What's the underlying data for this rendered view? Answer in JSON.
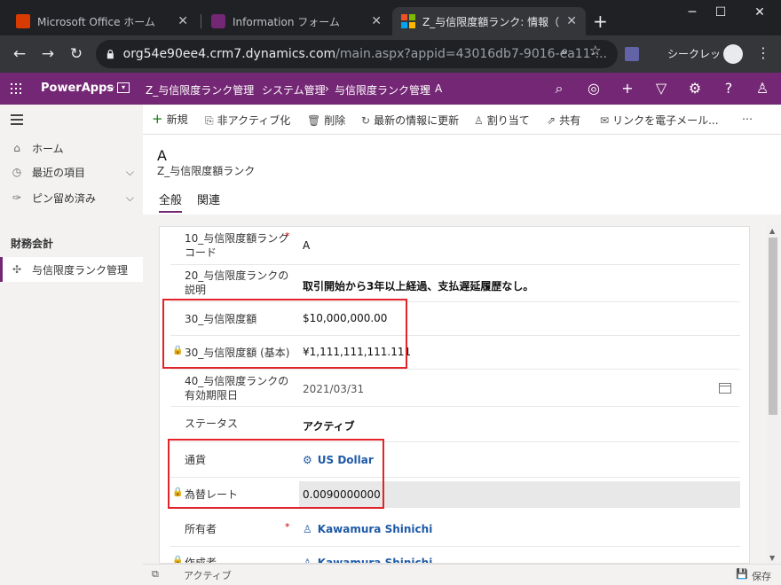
{
  "browser": {
    "tabs": [
      {
        "title": "Microsoft Office ホーム"
      },
      {
        "title": "Information フォーム"
      },
      {
        "title": "Z_与信限度額ランク: 情報（全"
      }
    ],
    "url_host": "org54e90ee4.crm7.dynamics.com",
    "url_path": "/main.aspx?appid=43016db7-9016-ea11-...",
    "incognito_label": "シークレット"
  },
  "header": {
    "brand": "PowerApps",
    "app_name": "Z_与信限度ランク管理",
    "breadcrumbs": [
      "システム管理",
      "与信限度ランク管理",
      "A"
    ],
    "brand_color": "#742774"
  },
  "nav": {
    "items": [
      {
        "label": "ホーム",
        "icon": "home-icon"
      },
      {
        "label": "最近の項目",
        "icon": "clock-icon"
      },
      {
        "label": "ピン留め済み",
        "icon": "pin-icon"
      }
    ],
    "group": "財務会計",
    "selected": {
      "label": "与信限度ランク管理",
      "icon": "puzzle-icon"
    }
  },
  "commands": [
    {
      "label": "新規",
      "icon": "plus-icon"
    },
    {
      "label": "非アクティブ化",
      "icon": "deactivate-icon"
    },
    {
      "label": "削除",
      "icon": "trash-icon"
    },
    {
      "label": "最新の情報に更新",
      "icon": "refresh-icon"
    },
    {
      "label": "割り当て",
      "icon": "person-icon"
    },
    {
      "label": "共有",
      "icon": "share-icon"
    },
    {
      "label": "リンクを電子メール...",
      "icon": "mail-icon"
    },
    {
      "label": "⋯",
      "icon": "more-icon"
    }
  ],
  "record": {
    "name": "A",
    "entity": "Z_与信限度額ランク",
    "tabs": [
      "全般",
      "関連"
    ]
  },
  "fields": [
    {
      "label": "10_与信限度額ランクコード",
      "value": "A",
      "required": true
    },
    {
      "label": "20_与信限度ランクの説明",
      "value": "取引開始から3年以上経過、支払遅延履歴なし。"
    },
    {
      "label": "30_与信限度額",
      "value": "$10,000,000.00"
    },
    {
      "label": "30_与信限度額 (基本)",
      "value": "¥1,111,111,111.111",
      "locked": true
    },
    {
      "label": "40_与信限度ランクの有効期限日",
      "value": "2021/03/31"
    },
    {
      "label": "ステータス",
      "value": "アクティブ"
    },
    {
      "label": "通貨",
      "value": "US Dollar"
    },
    {
      "label": "為替レート",
      "value": "0.0090000000",
      "locked": true
    },
    {
      "label": "所有者",
      "value": "Kawamura Shinichi",
      "required": true
    },
    {
      "label": "作成者",
      "value": "Kawamura Shinichi",
      "locked": true
    }
  ],
  "status": {
    "text": "アクティブ",
    "save_label": "保存"
  }
}
